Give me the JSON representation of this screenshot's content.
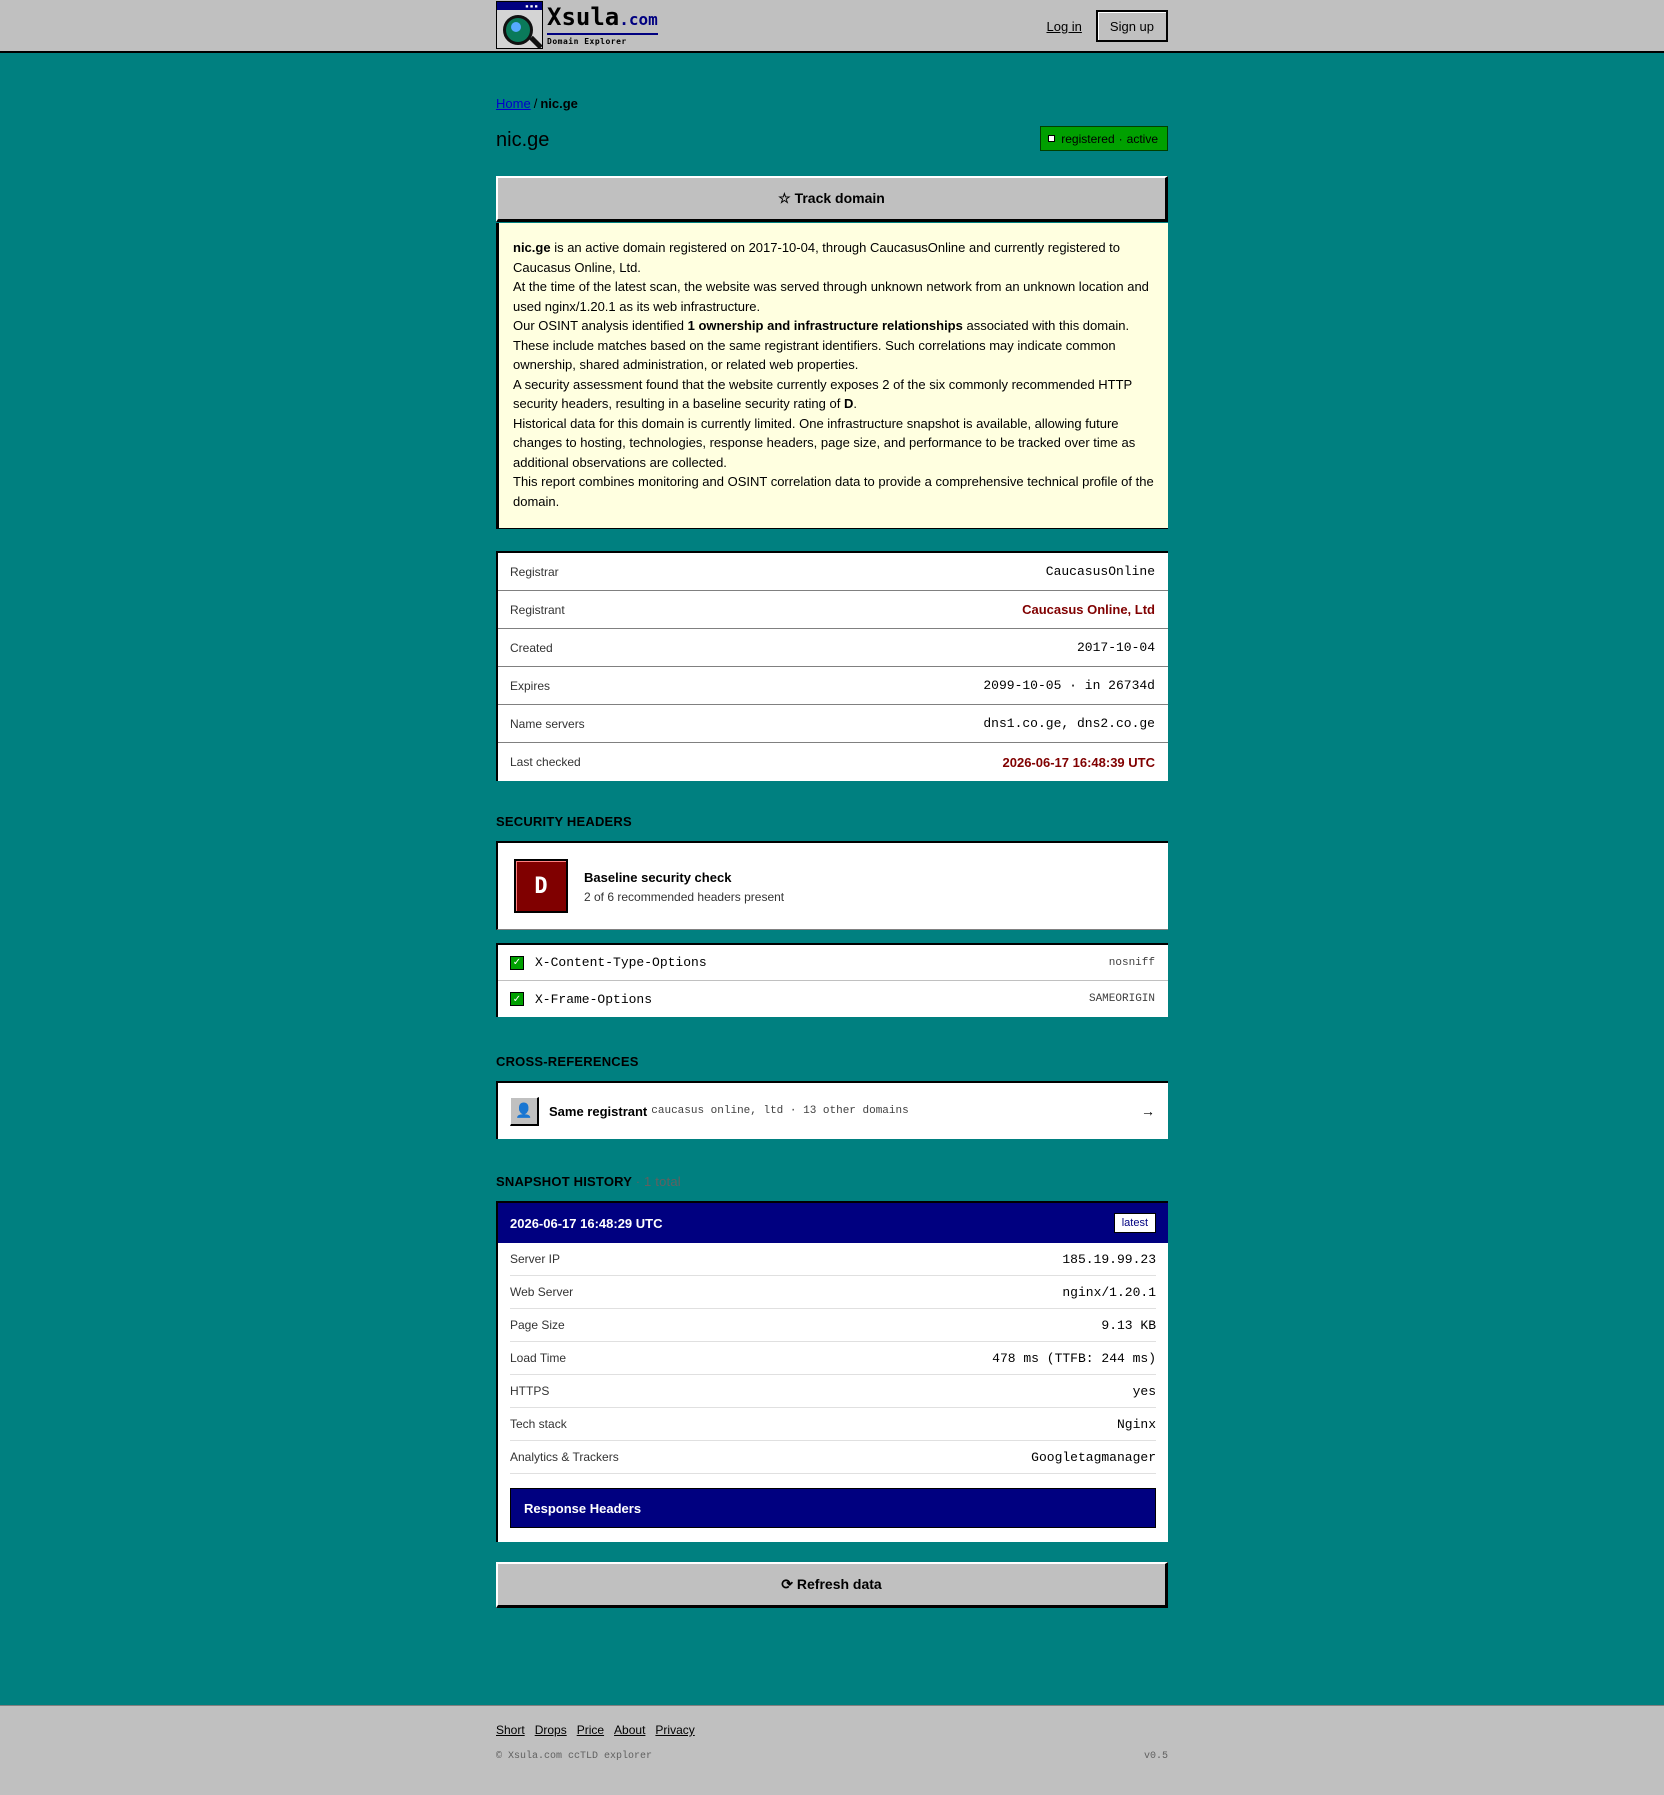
{
  "header": {
    "logo_name": "Xsula",
    "logo_tld": ".com",
    "logo_sub": "Domain Explorer",
    "login_label": "Log in",
    "signup_label": "Sign up"
  },
  "breadcrumb": {
    "home": "Home",
    "separator": "/",
    "current": "nic.ge"
  },
  "domain": {
    "title": "nic.ge",
    "status_registered": "registered",
    "status_dot": "·",
    "status_active": "active",
    "status_color": "#00a000"
  },
  "track_label": "☆ Track domain",
  "summary": {
    "p1_domain": "nic.ge",
    "p1_rest": " is an active domain registered on 2017-10-04, through CaucasusOnline and currently registered to Caucasus Online, Ltd.",
    "p2": "At the time of the latest scan, the website was served through unknown network from an unknown location and used nginx/1.20.1 as its web infrastructure.",
    "p3_pre": "Our OSINT analysis identified ",
    "p3_bold": "1 ownership and infrastructure relationships",
    "p3_post": " associated with this domain. These include matches based on the same registrant identifiers. Such correlations may indicate common ownership, shared administration, or related web properties.",
    "p4_pre": "A security assessment found that the website currently exposes 2 of the six commonly recommended HTTP security headers, resulting in a baseline security rating of ",
    "p4_bold": "D",
    "p4_post": ".",
    "p5": "Historical data for this domain is currently limited. One infrastructure snapshot is available, allowing future changes to hosting, technologies, response headers, page size, and performance to be tracked over time as additional observations are collected.",
    "p6": "This report combines monitoring and OSINT correlation data to provide a comprehensive technical profile of the domain."
  },
  "info": {
    "registrar_label": "Registrar",
    "registrar": "CaucasusOnline",
    "registrant_label": "Registrant",
    "registrant": "Caucasus Online, Ltd",
    "created_label": "Created",
    "created": "2017-10-04",
    "expires_label": "Expires",
    "expires": "2099-10-05 · in 26734d",
    "ns_label": "Name servers",
    "ns": "dns1.co.ge, dns2.co.ge",
    "checked_label": "Last checked",
    "checked": "2026-06-17 16:48:39 UTC"
  },
  "security": {
    "section_title": "SECURITY HEADERS",
    "grade": "D",
    "grade_color": "#800000",
    "card_title": "Baseline security check",
    "card_sub": "2 of 6 recommended headers present",
    "check_icon": "✓",
    "headers": [
      {
        "name": "X-Content-Type-Options",
        "value": "nosniff"
      },
      {
        "name": "X-Frame-Options",
        "value": "SAMEORIGIN"
      }
    ]
  },
  "xref": {
    "section_title": "CROSS-REFERENCES",
    "icon": "👤",
    "label": "Same registrant",
    "meta": "caucasus online, ltd · 13 other domains",
    "arrow": "→"
  },
  "snapshots": {
    "section_title": "SNAPSHOT HISTORY",
    "count": "· 1 total",
    "date": "2026-06-17 16:48:29 UTC",
    "badge": "latest",
    "rows": [
      {
        "k": "Server IP",
        "v": "185.19.99.23"
      },
      {
        "k": "Web Server",
        "v": "nginx/1.20.1"
      },
      {
        "k": "Page Size",
        "v": "9.13 KB"
      },
      {
        "k": "Load Time",
        "v": "478 ms (TTFB: 244 ms)"
      },
      {
        "k": "HTTPS",
        "v": "yes"
      },
      {
        "k": "Tech stack",
        "v": "Nginx"
      },
      {
        "k": "Analytics & Trackers",
        "v": "Googletagmanager"
      }
    ],
    "response_headers_label": "Response Headers"
  },
  "refresh_label": "⟳ Refresh data",
  "footer": {
    "links": [
      "Short",
      "Drops",
      "Price",
      "About",
      "Privacy"
    ],
    "copyright": "© Xsula.com ccTLD explorer",
    "version": "v0.5"
  }
}
